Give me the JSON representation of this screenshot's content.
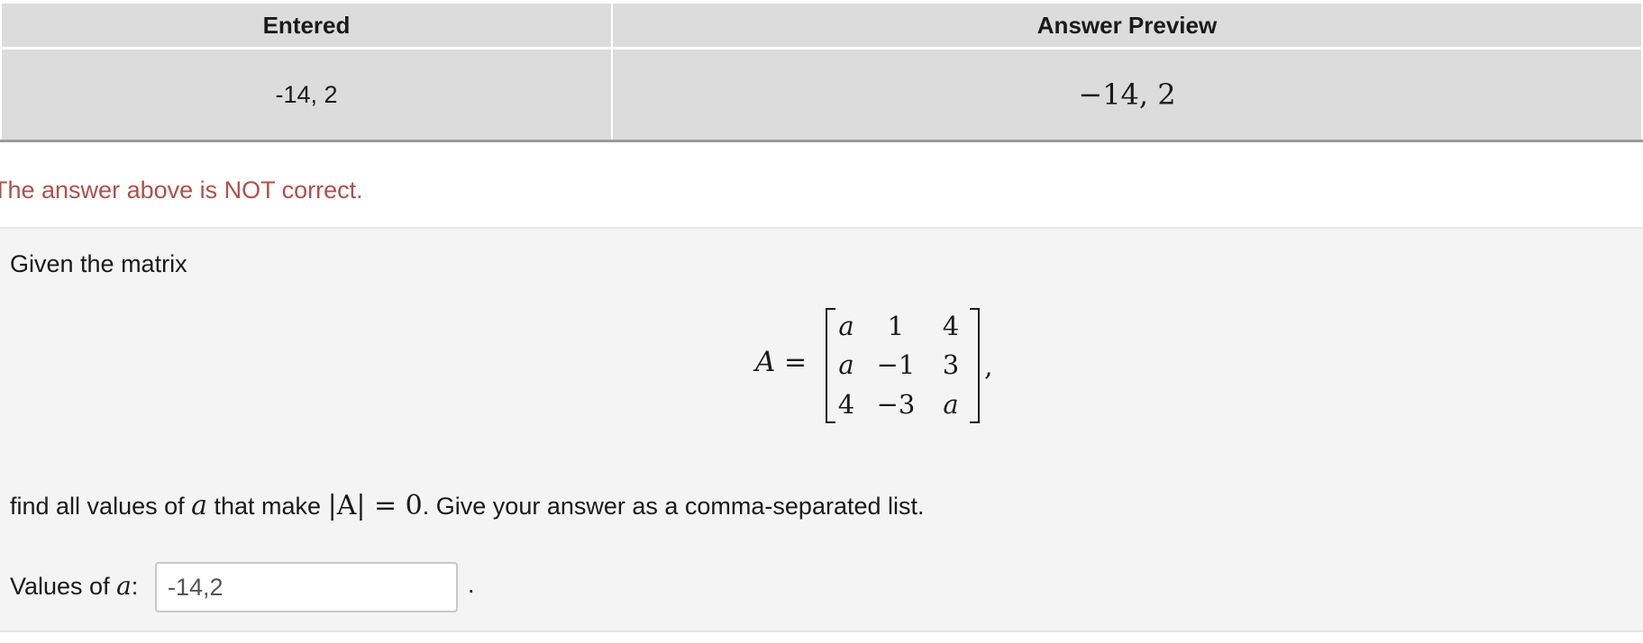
{
  "results_table": {
    "headers": [
      "Entered",
      "Answer Preview"
    ],
    "row": {
      "entered": "-14, 2",
      "preview": "−14, 2"
    }
  },
  "feedback": {
    "message": "The answer above is NOT correct.",
    "color": "#b0504a"
  },
  "problem": {
    "intro": "Given the matrix",
    "matrix_name": "A",
    "equals": "=",
    "matrix": [
      [
        "a",
        "1",
        "4"
      ],
      [
        "a",
        "−1",
        "3"
      ],
      [
        "4",
        "−3",
        "a"
      ]
    ],
    "matrix_trailing": ",",
    "question": {
      "part1": "find all values of ",
      "var": "a",
      "part2": " that make ",
      "det_expr": "|A| = 0",
      "part3": ". Give your answer as a comma-separated list."
    },
    "answer": {
      "label_prefix": "Values of ",
      "label_var": "a",
      "label_suffix": ":",
      "value": "-14,2",
      "trailing": "."
    }
  }
}
